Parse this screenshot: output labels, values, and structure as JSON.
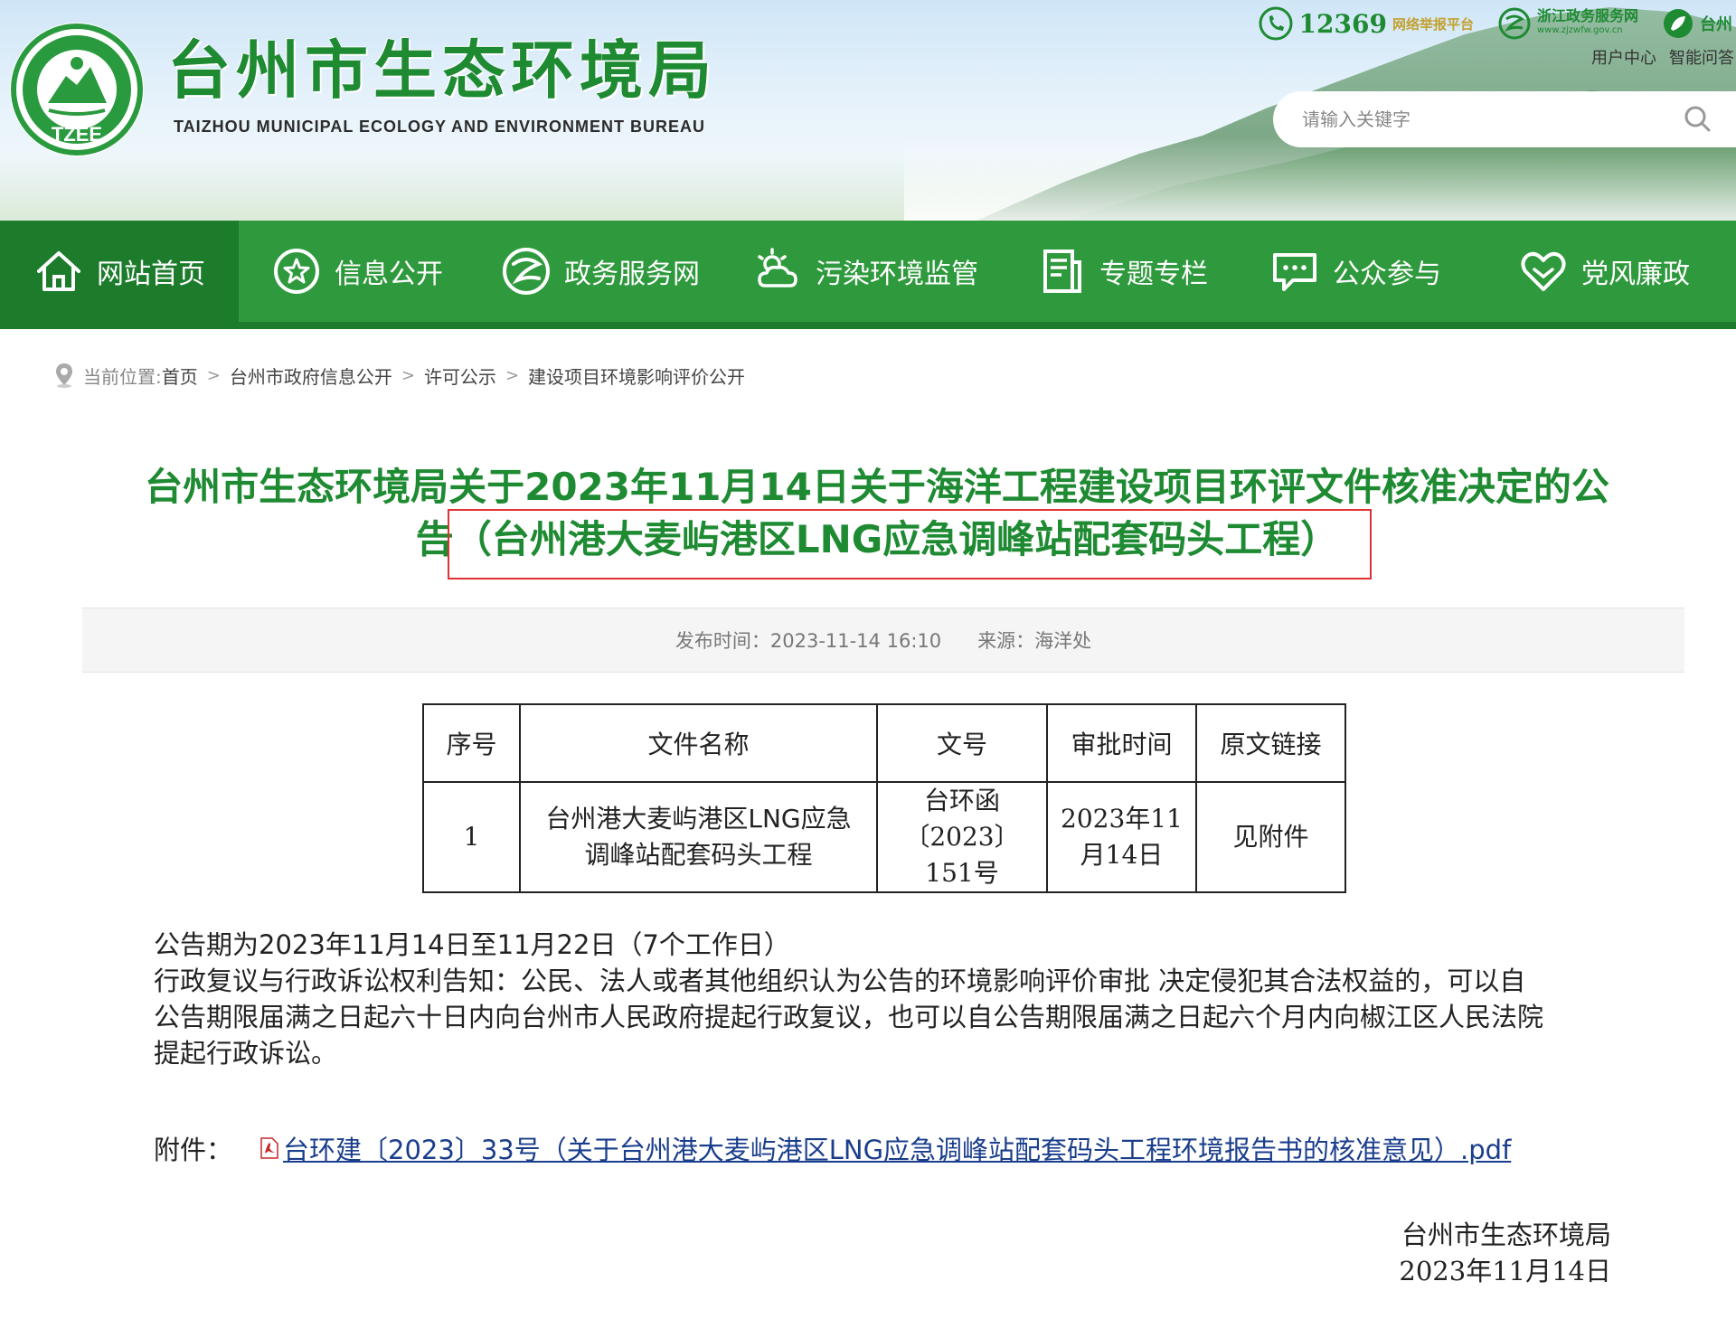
{
  "header": {
    "site_title": "台州市生态环境局",
    "site_subtitle": "TAIZHOU MUNICIPAL ECOLOGY AND ENVIRONMENT BUREAU",
    "logo_text": "TZEE",
    "top_links": {
      "hotline_number": "12369",
      "hotline_label": "网络举报平台",
      "zj_service_name": "浙江政务服务网",
      "zj_service_url": "www.zjzwfw.gov.cn",
      "taizhou_label": "台州"
    },
    "user_links": [
      "用户中心",
      "智能问答"
    ],
    "search": {
      "placeholder": "请输入关键字"
    }
  },
  "nav": {
    "items": [
      {
        "label": "网站首页",
        "icon": "home-icon"
      },
      {
        "label": "信息公开",
        "icon": "star-circle-icon"
      },
      {
        "label": "政务服务网",
        "icon": "zj-service-icon"
      },
      {
        "label": "污染环境监管",
        "icon": "sun-cloud-icon"
      },
      {
        "label": "专题专栏",
        "icon": "document-icon"
      },
      {
        "label": "公众参与",
        "icon": "chat-icon"
      },
      {
        "label": "党风廉政",
        "icon": "heart-icon"
      }
    ],
    "active_index": 0
  },
  "breadcrumb": {
    "label": "当前位置:",
    "items": [
      "首页",
      "台州市政府信息公开",
      "许可公示",
      "建设项目环境影响评价公开"
    ],
    "separator": ">"
  },
  "article": {
    "title_line1": "台州市生态环境局关于2023年11月14日关于海洋工程建设项目环评文件核准决定的公",
    "title_line2_prefix": "告",
    "title_line2_highlight": "（台州港大麦屿港区LNG应急调峰站配套码头工程）",
    "meta": {
      "publish_time": "发布时间：2023-11-14 16:10",
      "source": "来源：海洋处"
    },
    "table": {
      "headers": [
        "序号",
        "文件名称",
        "文号",
        "审批时间",
        "原文链接"
      ],
      "rows": [
        {
          "index": "1",
          "name_line1": "台州港大麦屿港区LNG应急",
          "name_line2": "调峰站配套码头工程",
          "doc_no_line1": "台环函",
          "doc_no_line2": "〔2023〕",
          "doc_no_line3": "151号",
          "date_line1": "2023年11",
          "date_line2": "月14日",
          "link": "见附件"
        }
      ]
    },
    "body": {
      "line1": "公告期为2023年11月14日至11月22日（7个工作日）",
      "line2": "行政复议与行政诉讼权利告知：公民、法人或者其他组织认为公告的环境影响评价审批 决定侵犯其合法权益的，可以自",
      "line3": "公告期限届满之日起六十日内向台州市人民政府提起行政复议，也可以自公告期限届满之日起六个月内向椒江区人民法院",
      "line4": "提起行政诉讼。"
    },
    "attachment": {
      "label": "附件：",
      "file": "台环建〔2023〕33号（关于台州港大麦屿港区LNG应急调峰站配套码头工程环境报告书的核准意见）.pdf"
    },
    "signature": {
      "org": "台州市生态环境局",
      "date": "2023年11月14日"
    }
  },
  "colors": {
    "brand_green": "#1e8a32",
    "nav_green": "#2f9a3d",
    "nav_dark": "#1c7c2c",
    "highlight_red": "#e03030",
    "link_blue": "#1a3e8c"
  }
}
